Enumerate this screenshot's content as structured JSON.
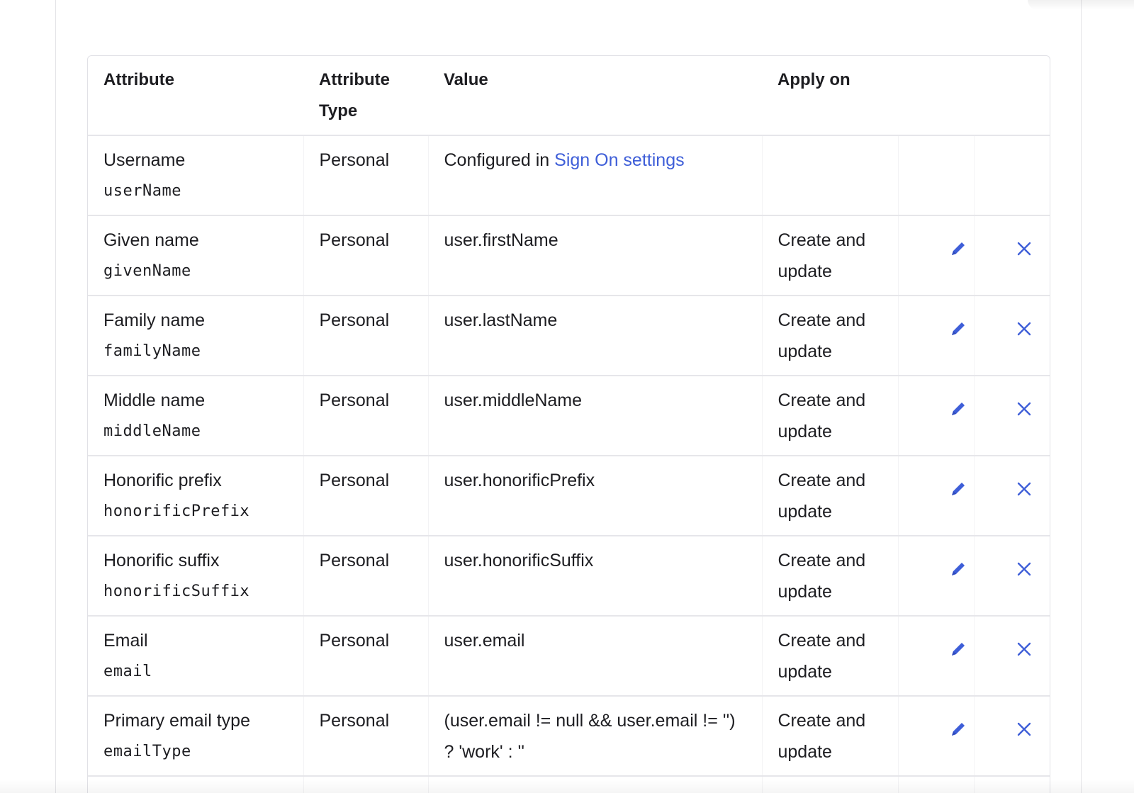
{
  "table": {
    "headers": {
      "attribute": "Attribute",
      "attribute_type": "Attribute Type",
      "value": "Value",
      "apply_on": "Apply on"
    },
    "rows": [
      {
        "name": "Username",
        "key": "userName",
        "type": "Personal",
        "value_prefix": "Configured in ",
        "value_link": "Sign On settings",
        "apply_on": ""
      },
      {
        "name": "Given name",
        "key": "givenName",
        "type": "Personal",
        "value": "user.firstName",
        "apply_on": "Create and update"
      },
      {
        "name": "Family name",
        "key": "familyName",
        "type": "Personal",
        "value": "user.lastName",
        "apply_on": "Create and update"
      },
      {
        "name": "Middle name",
        "key": "middleName",
        "type": "Personal",
        "value": "user.middleName",
        "apply_on": "Create and update"
      },
      {
        "name": "Honorific prefix",
        "key": "honorificPrefix",
        "type": "Personal",
        "value": "user.honorificPrefix",
        "apply_on": "Create and update"
      },
      {
        "name": "Honorific suffix",
        "key": "honorificSuffix",
        "type": "Personal",
        "value": "user.honorificSuffix",
        "apply_on": "Create and update"
      },
      {
        "name": "Email",
        "key": "email",
        "type": "Personal",
        "value": "user.email",
        "apply_on": "Create and update"
      },
      {
        "name": "Primary email type",
        "key": "emailType",
        "type": "Personal",
        "value": "(user.email != null && user.email != '') ? 'work' : ''",
        "apply_on": "Create and update"
      }
    ]
  },
  "icons": {
    "edit": "pencil-icon",
    "delete": "close-icon"
  },
  "colors": {
    "accent": "#3e5ed8",
    "text": "#1d1d21",
    "border": "#e6e6ea"
  }
}
